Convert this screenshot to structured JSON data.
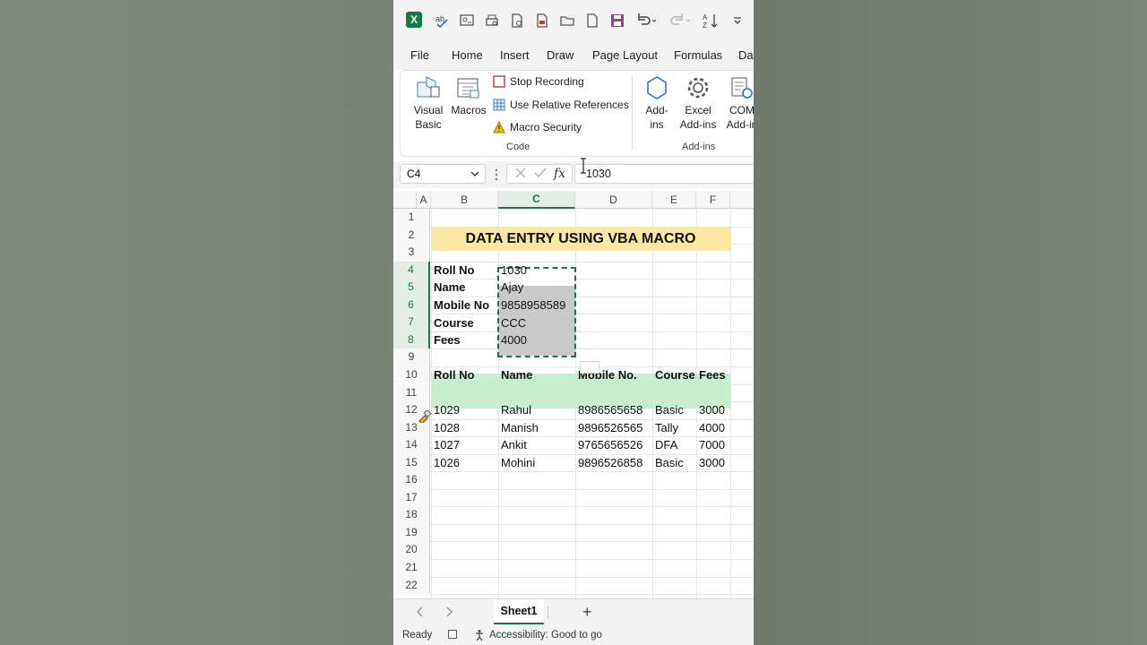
{
  "toolbar": {
    "icons": [
      "excel-logo-icon",
      "spelling-icon",
      "form-icon",
      "print-preview-icon",
      "document-icon",
      "save-as-icon",
      "open-folder-icon",
      "new-file-icon",
      "save-icon",
      "undo-icon",
      "redo-icon",
      "sort-icon",
      "customize-toolbar-icon"
    ],
    "app_badge": "X"
  },
  "tabs": [
    "File",
    "Home",
    "Insert",
    "Draw",
    "Page Layout",
    "Formulas",
    "Dat"
  ],
  "ribbon": {
    "code_group": {
      "visual_basic": [
        "Visual",
        "Basic"
      ],
      "macros": "Macros",
      "stop_recording": "Stop Recording",
      "relative_refs": "Use Relative References",
      "macro_security": "Macro Security",
      "label": "Code"
    },
    "addins_group": {
      "addins": [
        "Add-",
        "ins"
      ],
      "excel_addins": [
        "Excel",
        "Add-ins"
      ],
      "com_addins": [
        "COM",
        "Add-in"
      ],
      "label": "Add-ins"
    }
  },
  "formula_bar": {
    "name_box": "C4",
    "fx_label": "fx",
    "value": "1030"
  },
  "grid": {
    "columns": [
      "A",
      "B",
      "C",
      "D",
      "E",
      "F"
    ],
    "rows": [
      "1",
      "2",
      "3",
      "4",
      "5",
      "6",
      "7",
      "8",
      "9",
      "10",
      "11",
      "12",
      "13",
      "14",
      "15",
      "16",
      "17",
      "18",
      "19",
      "20",
      "21",
      "22"
    ],
    "title": "DATA ENTRY USING VBA MACRO",
    "form_labels": [
      "Roll No",
      "Name",
      "Mobile No",
      "Course",
      "Fees"
    ],
    "form_values": [
      "1030",
      "Ajay",
      "9858958589",
      "CCC",
      "4000"
    ],
    "table_headers": [
      "Roll No",
      "Name",
      "Mobile No.",
      "Course",
      "Fees"
    ],
    "table_rows": [
      [
        "1029",
        "Rahul",
        "8986565658",
        "Basic",
        "3000"
      ],
      [
        "1028",
        "Manish",
        "9896526565",
        "Tally",
        "4000"
      ],
      [
        "1027",
        "Ankit",
        "9765656526",
        "DFA",
        "7000"
      ],
      [
        "1026",
        "Mohini",
        "9896526858",
        "Basic",
        "3000"
      ]
    ]
  },
  "sheets": {
    "active": "Sheet1",
    "add": "+"
  },
  "status": {
    "ready": "Ready",
    "accessibility": "Accessibility: Good to go"
  },
  "colors": {
    "excel_green": "#217346",
    "title_fill": "#fbe7a1",
    "header_fill": "#c6efce",
    "selection_fill": "#c9c9c9"
  }
}
